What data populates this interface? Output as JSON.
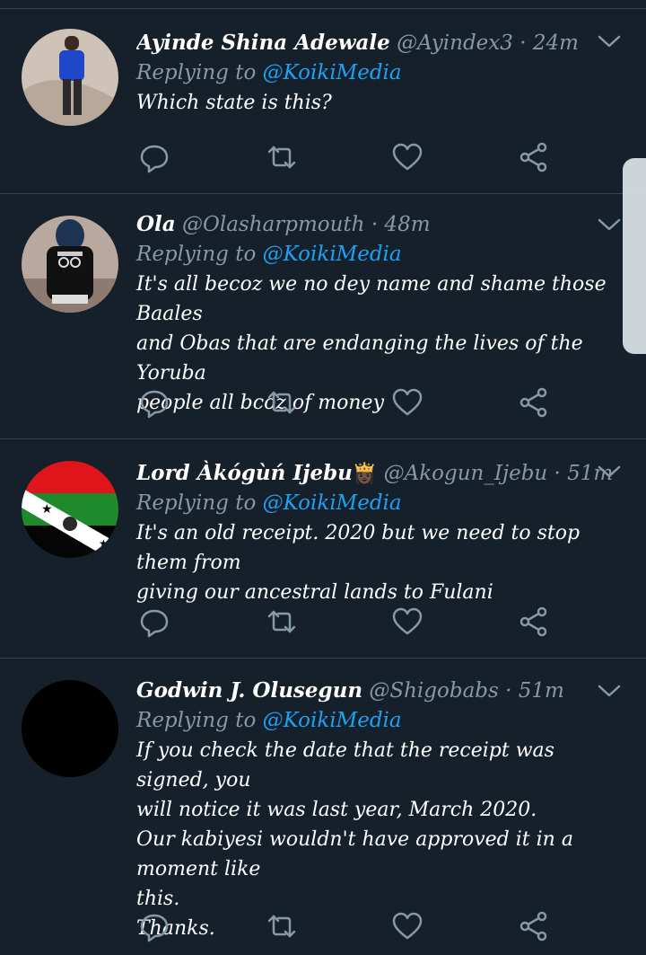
{
  "tweets": [
    {
      "name": "Ayinde Shina Adewale",
      "handle": "@Ayindex3",
      "time": "· 24m",
      "replying_prefix": "Replying to",
      "replying_to": "@KoikiMedia",
      "lines": [
        "Which state is this?"
      ]
    },
    {
      "name": "Ola",
      "handle": "@Olasharpmouth",
      "time": "· 48m",
      "replying_prefix": "Replying to",
      "replying_to": "@KoikiMedia",
      "lines": [
        "It's all becoz we no dey name and shame those Baales",
        "and Obas that are endanging the lives of the Yoruba",
        "people all bcoz of money"
      ]
    },
    {
      "name": "Lord Àkógùń Ijebu",
      "emoji": "👸🏿",
      "handle": "@Akogun_Ijebu",
      "time": "· 51m",
      "replying_prefix": "Replying to",
      "replying_to": "@KoikiMedia",
      "lines": [
        "It's an old receipt. 2020 but we need to stop them from",
        "giving our ancestral lands to Fulani"
      ]
    },
    {
      "name": "Godwin J. Olusegun",
      "handle": "@Shigobabs",
      "time": "· 51m",
      "replying_prefix": "Replying to",
      "replying_to": "@KoikiMedia",
      "lines": [
        "If you check the date that the receipt was signed, you",
        "will notice it was last year, March 2020.",
        "Our kabiyesi wouldn't have approved it in a moment like",
        "this.",
        "Thanks."
      ]
    }
  ],
  "icons": {
    "reply": "reply-icon",
    "retweet": "retweet-icon",
    "like": "heart-icon",
    "share": "share-icon",
    "menu": "chevron-down-icon"
  },
  "colors": {
    "background": "#15202b",
    "divider": "#38444d",
    "secondary_text": "#8899a6",
    "link": "#1da1f2"
  }
}
